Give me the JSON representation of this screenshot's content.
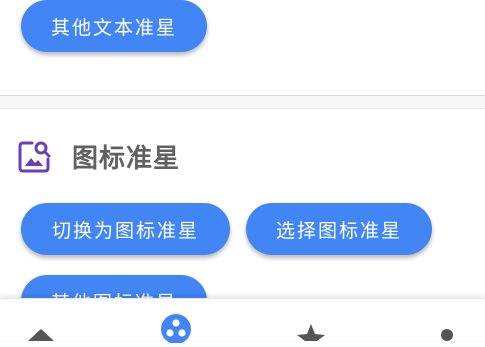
{
  "top_card": {
    "other_text_button": "其他文本准星"
  },
  "icon_section": {
    "title": "图标准星",
    "icon": "image-search-icon",
    "buttons": {
      "switch": "切换为图标准星",
      "select": "选择图标准星",
      "other": "其他图标准星"
    }
  },
  "bottom_nav": {
    "items": [
      {
        "icon": "home-icon",
        "active": false
      },
      {
        "icon": "crosshair-dots-icon",
        "active": true
      },
      {
        "icon": "star-icon",
        "active": false
      },
      {
        "icon": "dot-icon",
        "active": false
      }
    ]
  },
  "colors": {
    "accent": "#4285f4",
    "section_icon": "#6a3fb8",
    "title_text": "#616161",
    "nav_icon": "#555555"
  }
}
